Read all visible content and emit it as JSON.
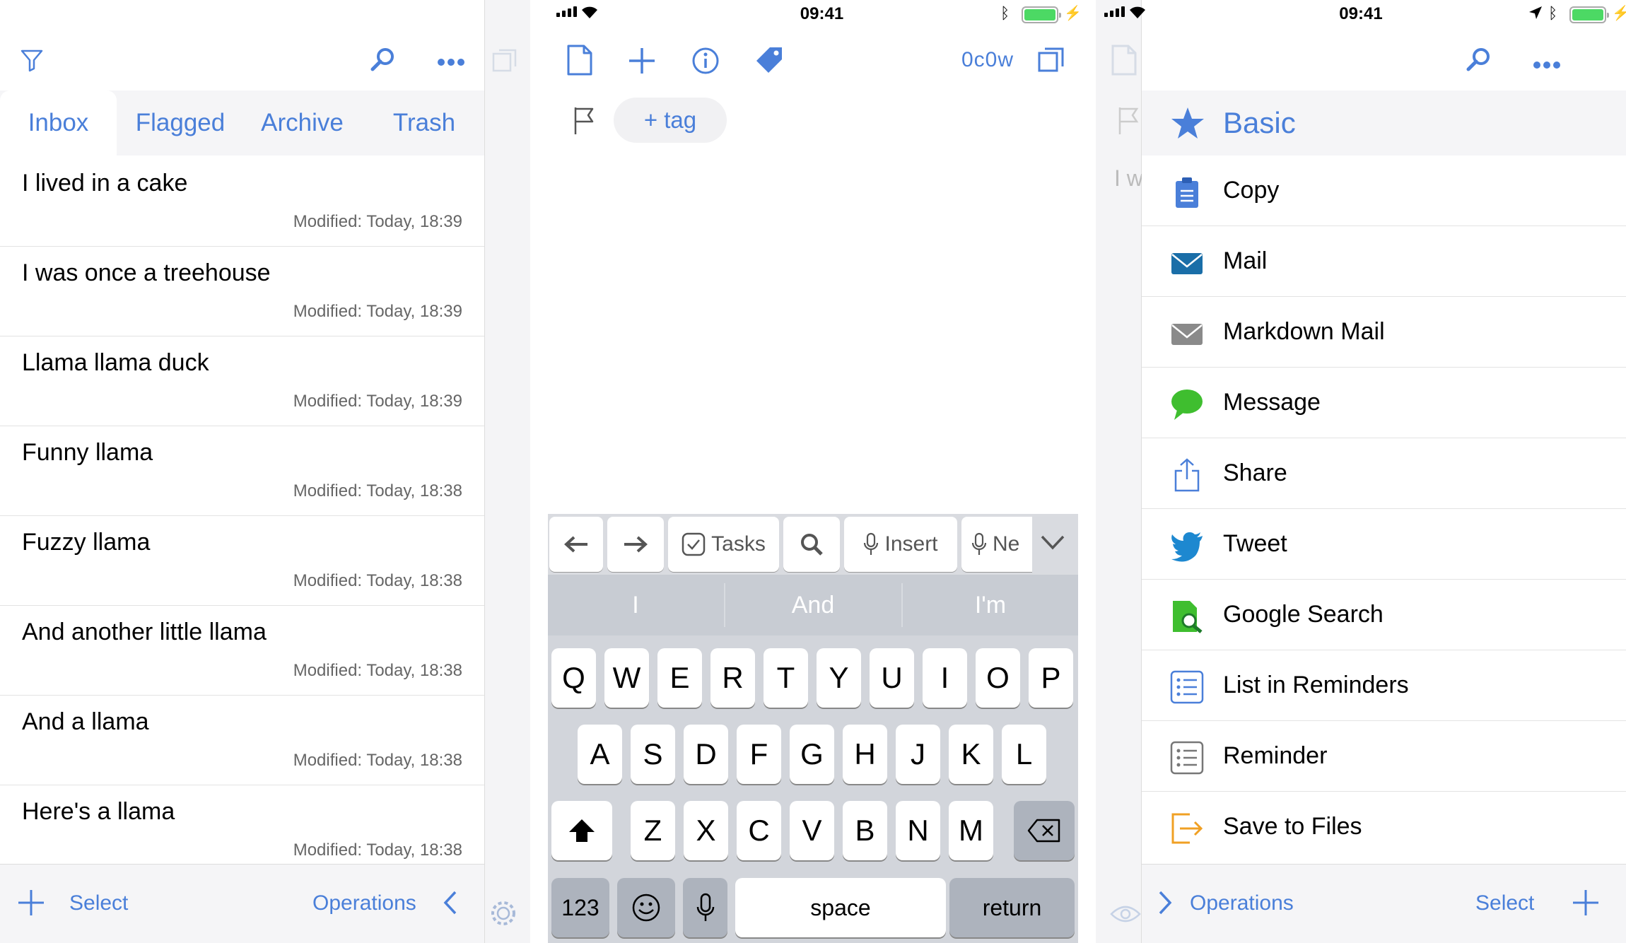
{
  "status": {
    "time": "09:41"
  },
  "colors": {
    "accent": "#4a7fd9",
    "battery": "#4cd964"
  },
  "screen1": {
    "tabs": [
      {
        "label": "Inbox"
      },
      {
        "label": "Flagged"
      },
      {
        "label": "Archive"
      },
      {
        "label": "Trash"
      }
    ],
    "active_tab": "Inbox",
    "notes": [
      {
        "title": "I lived in a cake",
        "modified": "Modified: Today, 18:39"
      },
      {
        "title": "I was once a treehouse",
        "modified": "Modified: Today, 18:39"
      },
      {
        "title": "Llama llama duck",
        "modified": "Modified: Today, 18:39"
      },
      {
        "title": "Funny llama",
        "modified": "Modified: Today, 18:38"
      },
      {
        "title": "Fuzzy llama",
        "modified": "Modified: Today, 18:38"
      },
      {
        "title": "And another little llama",
        "modified": "Modified: Today, 18:38"
      },
      {
        "title": "And a llama",
        "modified": "Modified: Today, 18:38"
      },
      {
        "title": "Here's a llama",
        "modified": "Modified: Today, 18:38"
      }
    ],
    "bottom": {
      "select": "Select",
      "operations": "Operations"
    }
  },
  "screen2": {
    "tag_button": "+ tag",
    "counter": "0c0w",
    "toolbar": {
      "tasks": "Tasks",
      "insert": "Insert",
      "new": "Ne"
    },
    "suggestions": [
      "I",
      "And",
      "I'm"
    ],
    "keys": {
      "row1": [
        "Q",
        "W",
        "E",
        "R",
        "T",
        "Y",
        "U",
        "I",
        "O",
        "P"
      ],
      "row2": [
        "A",
        "S",
        "D",
        "F",
        "G",
        "H",
        "J",
        "K",
        "L"
      ],
      "row3": [
        "Z",
        "X",
        "C",
        "V",
        "B",
        "N",
        "M"
      ],
      "numbers": "123",
      "space": "space",
      "return": "return"
    }
  },
  "screen3": {
    "peek_text": "I w",
    "section": "Basic",
    "actions": [
      {
        "label": "Copy",
        "icon": "clipboard-icon"
      },
      {
        "label": "Mail",
        "icon": "mail-icon"
      },
      {
        "label": "Markdown Mail",
        "icon": "markdown-mail-icon"
      },
      {
        "label": "Message",
        "icon": "message-bubble-icon"
      },
      {
        "label": "Share",
        "icon": "share-icon"
      },
      {
        "label": "Tweet",
        "icon": "twitter-bird-icon"
      },
      {
        "label": "Google Search",
        "icon": "google-search-icon"
      },
      {
        "label": "List in Reminders",
        "icon": "list-reminders-icon"
      },
      {
        "label": "Reminder",
        "icon": "reminder-icon"
      },
      {
        "label": "Save to Files",
        "icon": "save-to-files-icon"
      }
    ],
    "bottom": {
      "operations": "Operations",
      "select": "Select"
    }
  }
}
